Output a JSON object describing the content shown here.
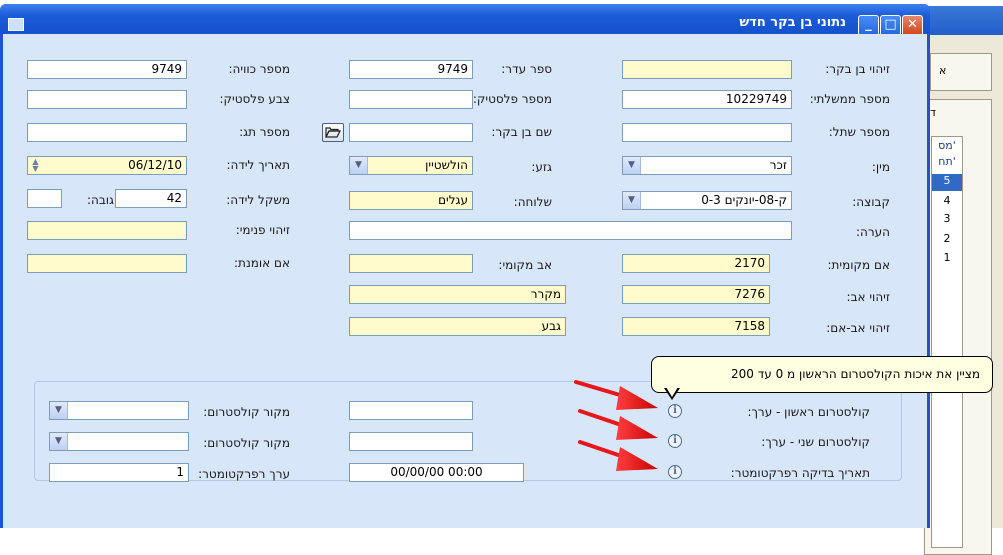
{
  "window": {
    "title": "נתוני בן בקר חדש",
    "minimize_glyph": "_",
    "maximize_glyph": "□",
    "close_glyph": "✕"
  },
  "fields": {
    "cow_id_label": "זיהוי בן בקר:",
    "cow_id_value": "",
    "herd_book_label": "ספר עדר:",
    "herd_book_value": "9749",
    "brand_no_label": "מספר כוויה:",
    "brand_no_value": "9749",
    "gov_no_label": "מספר ממשלתי:",
    "gov_no_value": "10229749",
    "plastic_no_label": "מספר פלסטיק:",
    "plastic_no_value": "",
    "plastic_color_label": "צבע פלסטיק:",
    "plastic_color_value": "",
    "shatel_no_label": "מספר שתל:",
    "shatel_no_value": "",
    "cow_name_label": "שם בן בקר:",
    "cow_name_value": "",
    "tag_no_label": "מספר תג:",
    "tag_no_value": "",
    "sex_label": "מין:",
    "sex_value": "זכר",
    "breed_label": "גזע:",
    "breed_value": "הולשטיין",
    "birth_date_label": "תאריך לידה:",
    "birth_date_value": "06/12/10",
    "group_label": "קבוצה:",
    "group_value": "ק-08-יונקים 0-3",
    "branch_label": "שלוחה:",
    "branch_value": "עגלים",
    "birth_weight_label": "משקל לידה:",
    "birth_weight_value": "42",
    "height_label": "גובה:",
    "height_value": "",
    "note_label": "הערה:",
    "note_value": "",
    "internal_id_label": "זיהוי פנימי:",
    "internal_id_value": "",
    "local_mother_label": "אם מקומית:",
    "local_mother_value": "2170",
    "local_father_label": "אב מקומי:",
    "local_father_value": "",
    "foster_mother_label": "אם אומנת:",
    "foster_mother_value": "",
    "father_id_label": "זיהוי אב:",
    "father_id_value": "7276",
    "father_name_value": "מקרר",
    "father_father_label": "זיהוי אב-אם:",
    "father_father_value": "7158",
    "father_father_name_value": "גבע"
  },
  "cholesterol": {
    "first_label": "קולסטרום ראשון  -   ערך:",
    "first_value": "",
    "first_source_label": "מקור קולסטרום:",
    "first_source_value": "",
    "second_label": "קולסטרום שני   -   ערך:",
    "second_value": "",
    "second_source_label": "מקור קולסטרום:",
    "second_source_value": "",
    "refractometer_date_label": "תאריך בדיקה רפרקטומטר:",
    "refractometer_date_value": "00/00/00 00:00",
    "refractometer_value_label": "ערך רפרקטומטר:",
    "refractometer_value": "1",
    "info_glyph": "i"
  },
  "tooltip": {
    "text": "מציין את איכות הקולסטרום הראשון מ 0 עד 200"
  },
  "background_window": {
    "tab1": "א",
    "tab2": "דו",
    "col_header_1": "מס'",
    "col_header_2": "תח'",
    "rows": [
      "5",
      "4",
      "3",
      "2",
      "1"
    ]
  },
  "colors": {
    "title_bar": "#1b5ad8",
    "client_bg": "#d8e6fa",
    "required_field": "#fffbcc",
    "arrow": "#e8161b",
    "selected_row": "#316ac5"
  }
}
